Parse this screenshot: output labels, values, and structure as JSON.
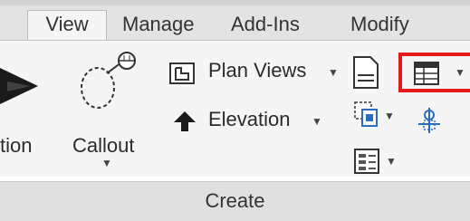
{
  "tabs": [
    "View",
    "Manage",
    "Add-Ins",
    "Modify"
  ],
  "ribbon": {
    "section_label": "tion",
    "callout_label": "Callout",
    "plan_views_label": "Plan  Views",
    "elevation_label": "Elevation"
  },
  "panel": {
    "name": "Create"
  },
  "colors": {
    "highlight": "#e31818"
  }
}
